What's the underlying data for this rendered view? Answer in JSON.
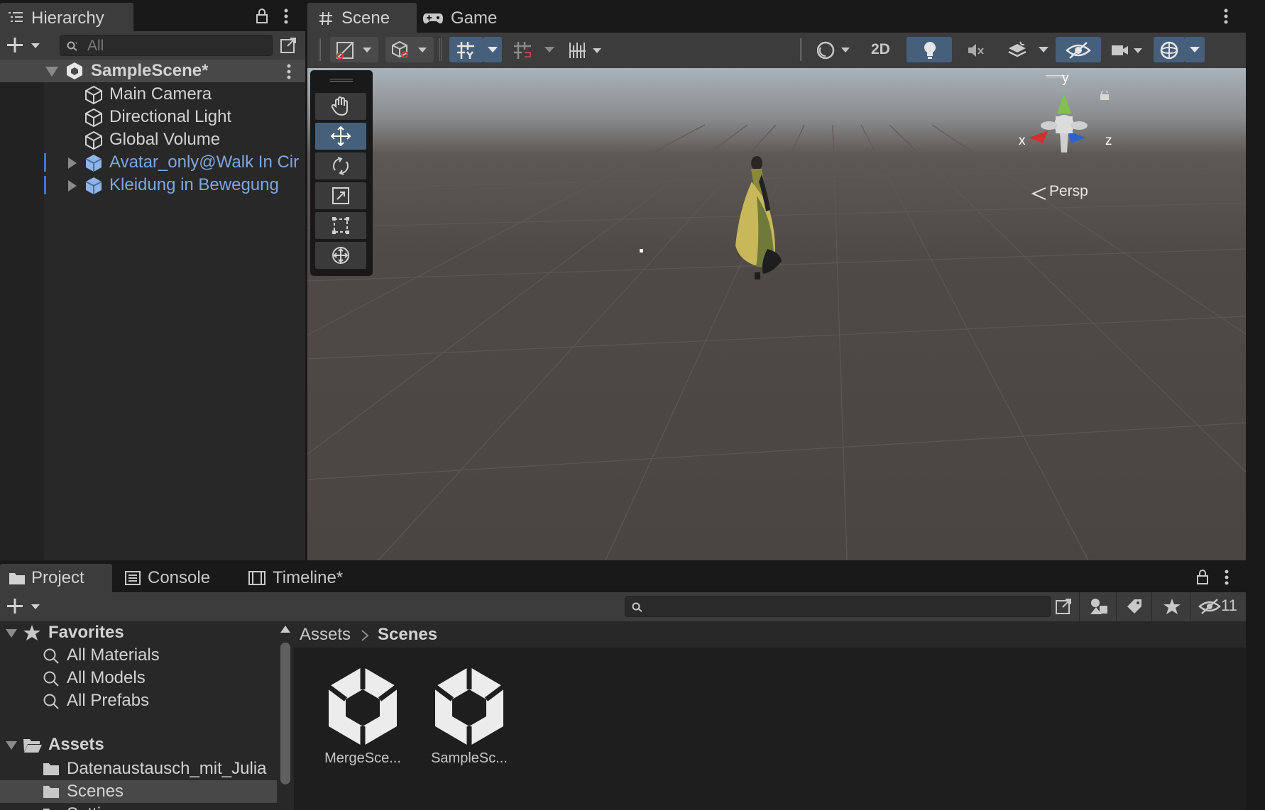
{
  "hierarchy": {
    "title": "Hierarchy",
    "search_placeholder": "All",
    "scene_name": "SampleScene*",
    "items": [
      {
        "label": "Main Camera",
        "type": "gameobject"
      },
      {
        "label": "Directional Light",
        "type": "gameobject"
      },
      {
        "label": "Global Volume",
        "type": "gameobject"
      },
      {
        "label": "Avatar_only@Walk In Cir",
        "type": "prefab"
      },
      {
        "label": "Kleidung in Bewegung",
        "type": "prefab"
      }
    ]
  },
  "scene": {
    "tabs": [
      {
        "label": "Scene",
        "icon": "hash-icon",
        "active": true
      },
      {
        "label": "Game",
        "icon": "gamepad-icon",
        "active": false
      }
    ],
    "toolbar": {
      "mode_2d": "2D"
    },
    "gizmo": {
      "x_label": "x",
      "y_label": "y",
      "z_label": "z",
      "projection": "Persp"
    },
    "colors": {
      "axis_x": "#d23030",
      "axis_y": "#82c050",
      "axis_z": "#2f62c8",
      "active_button": "#46607c"
    }
  },
  "project": {
    "tabs": [
      {
        "label": "Project",
        "icon": "folder-icon",
        "active": true
      },
      {
        "label": "Console",
        "icon": "console-icon",
        "active": false
      },
      {
        "label": "Timeline*",
        "icon": "timeline-icon",
        "active": false
      }
    ],
    "hidden_count": "11",
    "favorites": {
      "title": "Favorites",
      "items": [
        "All Materials",
        "All Models",
        "All Prefabs"
      ]
    },
    "assets": {
      "title": "Assets",
      "items": [
        "Datenaustausch_mit_Julia",
        "Scenes",
        "Settings"
      ]
    },
    "breadcrumb": [
      "Assets",
      "Scenes"
    ],
    "files": [
      {
        "label": "MergeSce...",
        "icon": "unity-scene-icon"
      },
      {
        "label": "SampleSc...",
        "icon": "unity-scene-icon"
      }
    ]
  }
}
